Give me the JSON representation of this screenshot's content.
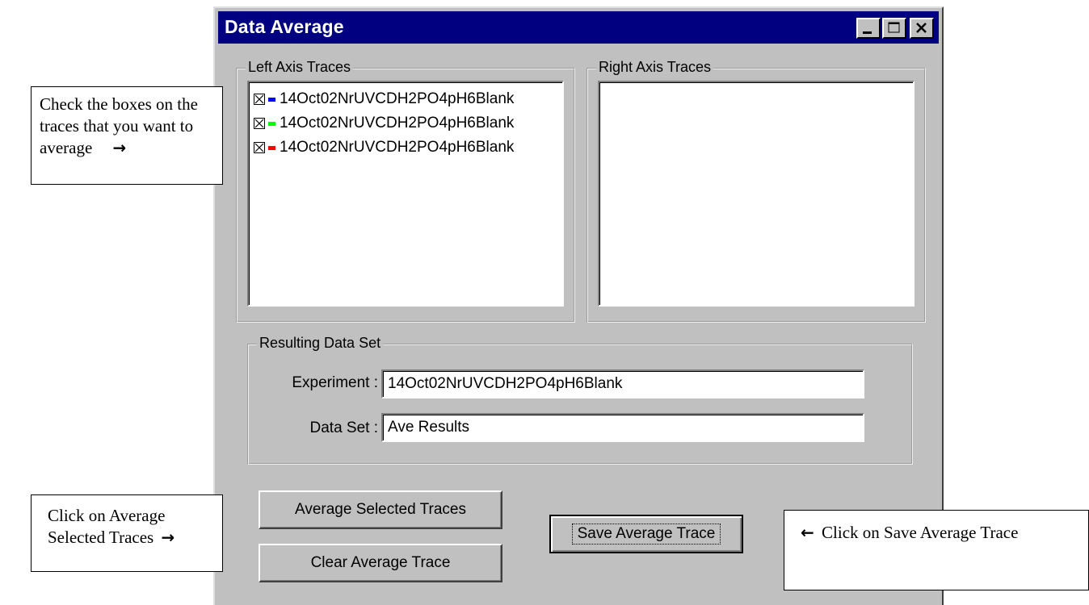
{
  "window": {
    "title": "Data Average",
    "controls": {
      "minimize_icon": "minimize-icon",
      "maximize_icon": "maximize-icon",
      "close_icon": "close-icon"
    }
  },
  "left_axis": {
    "legend": "Left Axis Traces",
    "traces": [
      {
        "label": "14Oct02NrUVCDH2PO4pH6Blank",
        "checked": true,
        "color": "#0000ff"
      },
      {
        "label": "14Oct02NrUVCDH2PO4pH6Blank",
        "checked": true,
        "color": "#00ff00"
      },
      {
        "label": "14Oct02NrUVCDH2PO4pH6Blank",
        "checked": true,
        "color": "#ff0000"
      }
    ]
  },
  "right_axis": {
    "legend": "Right Axis Traces",
    "traces": []
  },
  "result": {
    "legend": "Resulting Data Set",
    "experiment_label": "Experiment :",
    "experiment_value": "14Oct02NrUVCDH2PO4pH6Blank",
    "dataset_label": "Data Set :",
    "dataset_value": "Ave Results"
  },
  "buttons": {
    "average": "Average Selected Traces",
    "clear": "Clear Average Trace",
    "save": "Save Average Trace"
  },
  "callouts": {
    "check_boxes": {
      "text": "Check the boxes on the traces that you want to average",
      "arrow": "→"
    },
    "click_average": {
      "text": "Click on Average Selected Traces",
      "arrow": "→"
    },
    "click_save": {
      "arrow": "←",
      "text": "Click on Save Average Trace"
    }
  }
}
